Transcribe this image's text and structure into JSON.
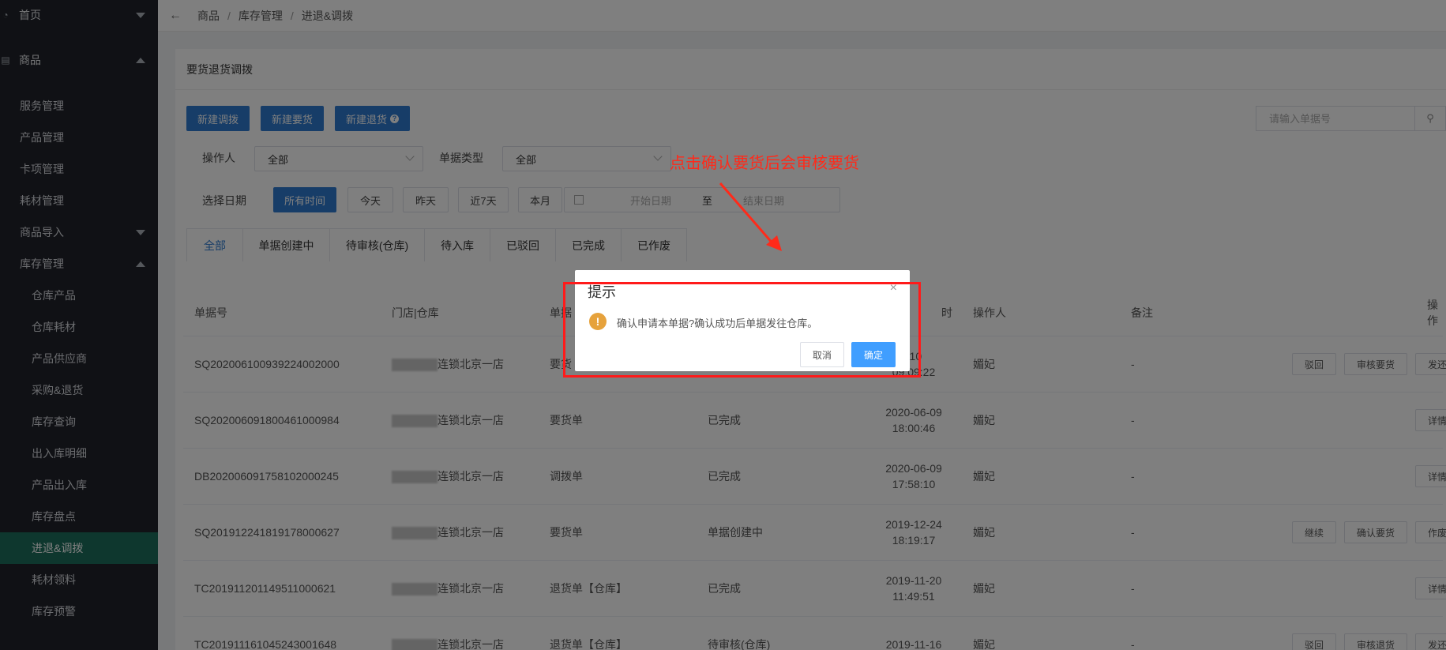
{
  "sidebar": {
    "home": "首页",
    "product": "商品",
    "items": [
      "服务管理",
      "产品管理",
      "卡项管理",
      "耗材管理"
    ],
    "import": "商品导入",
    "inventory": "库存管理",
    "sub_items": [
      "仓库产品",
      "仓库耗材",
      "产品供应商",
      "采购&退货",
      "库存查询",
      "出入库明细",
      "产品出入库",
      "库存盘点",
      "进退&调拨",
      "耗材领料",
      "库存预警"
    ]
  },
  "breadcrumb": [
    "商品",
    "库存管理",
    "进退&调拨"
  ],
  "panel": {
    "title": "要货退货调拨",
    "btn_transfer": "新建调拨",
    "btn_order": "新建要货",
    "btn_return": "新建退货",
    "search_placeholder": "请输入单据号"
  },
  "filters": {
    "operator_label": "操作人",
    "operator_value": "全部",
    "type_label": "单据类型",
    "type_value": "全部",
    "date_label": "选择日期",
    "date_buttons": [
      "所有时间",
      "今天",
      "昨天",
      "近7天",
      "本月"
    ],
    "start_date": "开始日期",
    "to": "至",
    "end_date": "结束日期"
  },
  "tabs": [
    "全部",
    "单据创建中",
    "待审核(仓库)",
    "待入库",
    "已驳回",
    "已完成",
    "已作废"
  ],
  "table": {
    "headers": [
      "单据号",
      "门店|仓库",
      "单据",
      "时",
      "操作人",
      "备注",
      "操作"
    ],
    "rows": [
      {
        "id": "SQ202006100939224002000",
        "store": "连锁北京一店",
        "type": "要货",
        "status": "",
        "date": "-10",
        "time": "09:09:22",
        "operator": "媚妃",
        "remark": "-",
        "ops": [
          "驳回",
          "审核要货",
          "发还"
        ]
      },
      {
        "id": "SQ202006091800461000984",
        "store": "连锁北京一店",
        "type": "要货单",
        "status": "已完成",
        "date": "2020-06-09",
        "time": "18:00:46",
        "operator": "媚妃",
        "remark": "-",
        "ops": [
          "详情"
        ]
      },
      {
        "id": "DB202006091758102000245",
        "store": "连锁北京一店",
        "type": "调拨单",
        "status": "已完成",
        "date": "2020-06-09",
        "time": "17:58:10",
        "operator": "媚妃",
        "remark": "-",
        "ops": [
          "详情"
        ]
      },
      {
        "id": "SQ201912241819178000627",
        "store": "连锁北京一店",
        "type": "要货单",
        "status": "单据创建中",
        "date": "2019-12-24",
        "time": "18:19:17",
        "operator": "媚妃",
        "remark": "-",
        "ops": [
          "继续",
          "确认要货",
          "作废"
        ]
      },
      {
        "id": "TC201911201149511000621",
        "store": "连锁北京一店",
        "type": "退货单【仓库】",
        "status": "已完成",
        "date": "2019-11-20",
        "time": "11:49:51",
        "operator": "媚妃",
        "remark": "-",
        "ops": [
          "详情"
        ]
      },
      {
        "id": "TC201911161045243001648",
        "store": "连锁北京一店",
        "type": "退货单【仓库】",
        "status": "待审核(仓库)",
        "date": "2019-11-16",
        "time": "",
        "operator": "媚妃",
        "remark": "-",
        "ops": [
          "驳回",
          "审核退货",
          "发还"
        ]
      }
    ]
  },
  "annotation": "点击确认要货后会审核要货",
  "modal": {
    "title": "提示",
    "close": "×",
    "warn": "!",
    "message": "确认申请本单据?确认成功后单据发往仓库。",
    "cancel": "取消",
    "ok": "确定"
  },
  "colors": {
    "sidebar_bg": "#20232a",
    "active_nav": "#1d6e5c",
    "primary": "#2e7bd0",
    "annotation": "#ff2a1a",
    "warn": "#e6a23c"
  }
}
